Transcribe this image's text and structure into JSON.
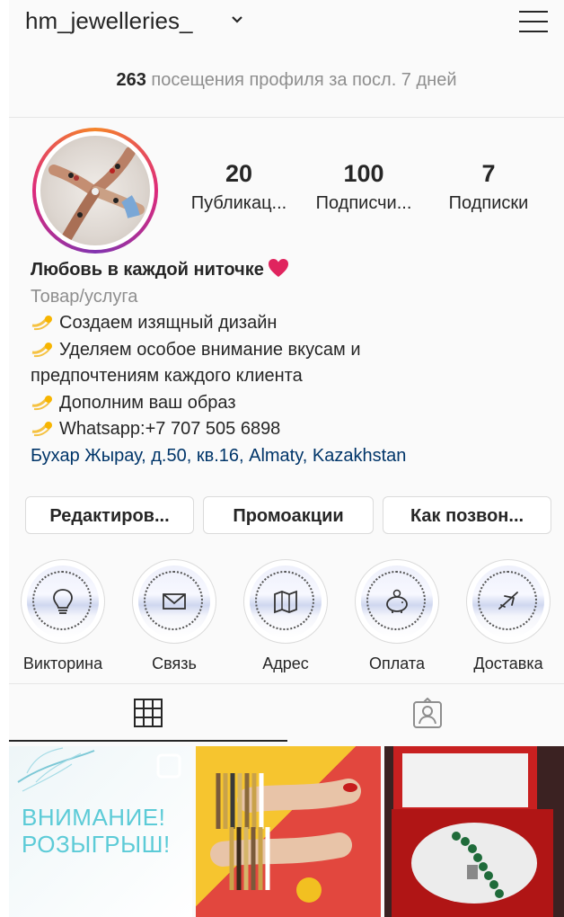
{
  "header": {
    "username": "hm_jewelleries_"
  },
  "insights": {
    "count": "263",
    "text": "посещения профиля за посл. 7 дней"
  },
  "stats": [
    {
      "value": "20",
      "label": "Публикац..."
    },
    {
      "value": "100",
      "label": "Подписчи..."
    },
    {
      "value": "7",
      "label": "Подписки"
    }
  ],
  "bio": {
    "name": "Любовь в каждой ниточке",
    "category": "Товар/услуга",
    "line1": "Создаем изящный дизайн",
    "line2a": "Уделяем особое внимание вкусам и",
    "line2b": "предпочтениям каждого клиента",
    "line3": "Дополним ваш образ",
    "line4": "Whatsapp:+7 707 505 6898",
    "address": "Бухар Жырау, д.50, кв.16, Almaty, Kazakhstan"
  },
  "buttons": {
    "edit": "Редактиров...",
    "promo": "Промоакции",
    "call": "Как позвон..."
  },
  "highlights": [
    {
      "label": "Викторина",
      "icon": "lightbulb-icon"
    },
    {
      "label": "Связь",
      "icon": "envelope-icon"
    },
    {
      "label": "Адрес",
      "icon": "map-icon"
    },
    {
      "label": "Оплата",
      "icon": "piggy-bank-icon"
    },
    {
      "label": "Доставка",
      "icon": "airplane-icon"
    }
  ],
  "tabs": {
    "grid": "grid-icon",
    "tagged": "tagged-person-icon"
  },
  "posts": [
    {
      "text_line1": "ВНИМАНИЕ!",
      "text_line2": "РОЗЫГРЫШ!"
    }
  ],
  "colors": {
    "accent_link": "#003569",
    "muted": "#8e8e8e",
    "ring_start": "#f58529",
    "ring_end": "#dd2a7b",
    "post_text": "#5ccbd7"
  }
}
